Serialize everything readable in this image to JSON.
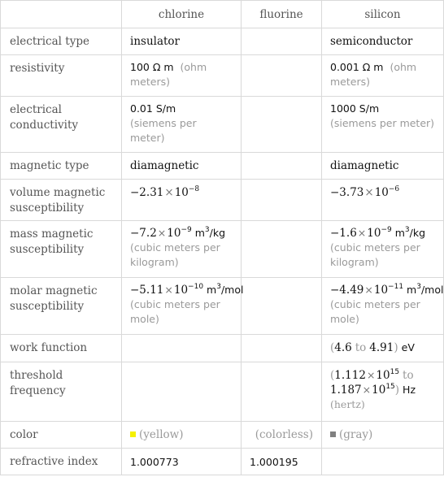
{
  "columns": [
    "",
    "chlorine",
    "fluorine",
    "silicon"
  ],
  "rows": {
    "electrical_type": {
      "label": "electrical type",
      "chlorine": "insulator",
      "fluorine": "",
      "silicon": "semiconductor"
    },
    "resistivity": {
      "label": "resistivity",
      "chlorine": {
        "value": "100",
        "unit": "Ω m",
        "desc": "(ohm meters)"
      },
      "silicon": {
        "value": "0.001",
        "unit": "Ω m",
        "desc": "(ohm meters)"
      }
    },
    "electrical_conductivity": {
      "label": "electrical conductivity",
      "chlorine": {
        "value": "0.01",
        "unit": "S/m",
        "desc": "(siemens per meter)"
      },
      "silicon": {
        "value": "1000",
        "unit": "S/m",
        "desc": "(siemens per meter)"
      }
    },
    "magnetic_type": {
      "label": "magnetic type",
      "chlorine": "diamagnetic",
      "silicon": "diamagnetic"
    },
    "volume_magnetic_susceptibility": {
      "label": "volume magnetic susceptibility",
      "chlorine": {
        "mantissa": "−2.31",
        "base": "10",
        "exp": "−8"
      },
      "silicon": {
        "mantissa": "−3.73",
        "base": "10",
        "exp": "−6"
      }
    },
    "mass_magnetic_susceptibility": {
      "label": "mass magnetic susceptibility",
      "chlorine": {
        "mantissa": "−7.2",
        "base": "10",
        "exp": "−9",
        "unit_a": "m",
        "unit_exp": "3",
        "unit_b": "/kg",
        "desc": "(cubic meters per kilogram)"
      },
      "silicon": {
        "mantissa": "−1.6",
        "base": "10",
        "exp": "−9",
        "unit_a": "m",
        "unit_exp": "3",
        "unit_b": "/kg",
        "desc": "(cubic meters per kilogram)"
      }
    },
    "molar_magnetic_susceptibility": {
      "label": "molar magnetic susceptibility",
      "chlorine": {
        "mantissa": "−5.11",
        "base": "10",
        "exp": "−10",
        "unit_a": "m",
        "unit_exp": "3",
        "unit_b": "/mol",
        "desc": "(cubic meters per mole)"
      },
      "silicon": {
        "mantissa": "−4.49",
        "base": "10",
        "exp": "−11",
        "unit_a": "m",
        "unit_exp": "3",
        "unit_b": "/mol",
        "desc": "(cubic meters per mole)"
      }
    },
    "work_function": {
      "label": "work function",
      "silicon": {
        "open": "(",
        "low": "4.6",
        "to": "to",
        "high": "4.91",
        "close": ")",
        "unit": "eV"
      }
    },
    "threshold_frequency": {
      "label": "threshold frequency",
      "silicon": {
        "open": "(",
        "low_mantissa": "1.112",
        "low_exp": "15",
        "to": "to",
        "high_mantissa": "1.187",
        "high_exp": "15",
        "base": "10",
        "close": ")",
        "unit": "Hz",
        "desc": "(hertz)"
      }
    },
    "color": {
      "label": "color",
      "chlorine": {
        "swatch": "#f5f000",
        "name": "(yellow)"
      },
      "fluorine": {
        "name": "(colorless)"
      },
      "silicon": {
        "swatch": "#808080",
        "name": "(gray)"
      }
    },
    "refractive_index": {
      "label": "refractive index",
      "chlorine": "1.000773",
      "fluorine": "1.000195",
      "silicon": ""
    }
  },
  "symbols": {
    "times": "×"
  }
}
